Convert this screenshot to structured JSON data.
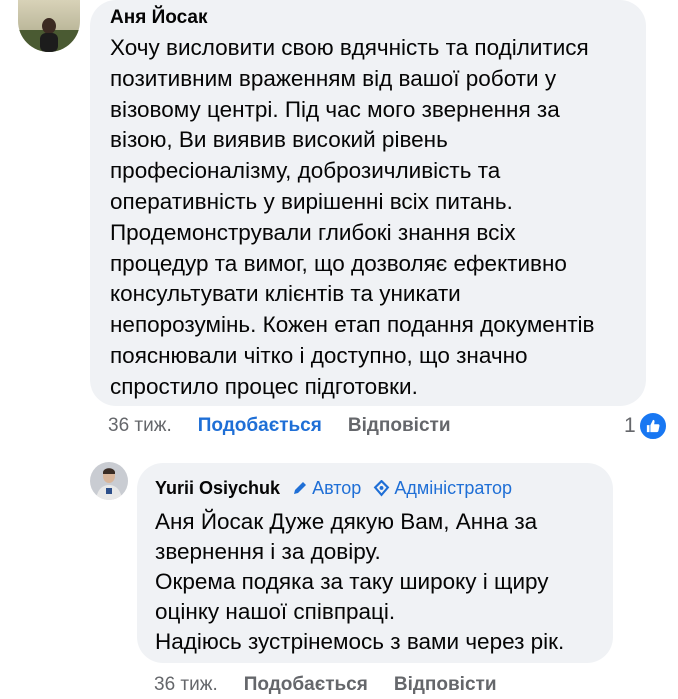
{
  "comment": {
    "author": "Аня Йосак",
    "text": "Хочу висловити свою вдячність та поділитися\nпозитивним враженням від вашої роботи у\nвізовому центрі. Під час мого звернення за\nвізою, Ви виявив високий рівень\nпрофесіоналізму, доброзичливість та\nоперативність у вирішенні всіх питань.\nПродемонстрували глибокі знання всіх\nпроцедур та вимог, що дозволяє ефективно\nконсультувати клієнтів та уникати\nнепорозумінь. Кожен етап подання документів\nпояснювали чітко і доступно, що значно\nспростило процес підготовки.",
    "time": "36 тиж.",
    "like_label": "Подобається",
    "reply_label": "Відповісти",
    "reaction_count": "1"
  },
  "reply": {
    "author": "Yurii Osiychuk",
    "author_badge": "Автор",
    "admin_badge": "Адміністратор",
    "text": "Аня Йосак Дуже дякую Вам, Анна за\nзвернення і за довіру.\nОкрема подяка за таку широку і щиру\nоцінку нашої співпраці.\nНадіюсь зустрінемось з вами через рік.",
    "time": "36 тиж.",
    "like_label": "Подобається",
    "reply_label": "Відповісти"
  },
  "colors": {
    "bubble": "#f0f2f5",
    "link_blue": "#1f6fd6",
    "muted": "#65676b",
    "like_badge": "#1877f2"
  }
}
